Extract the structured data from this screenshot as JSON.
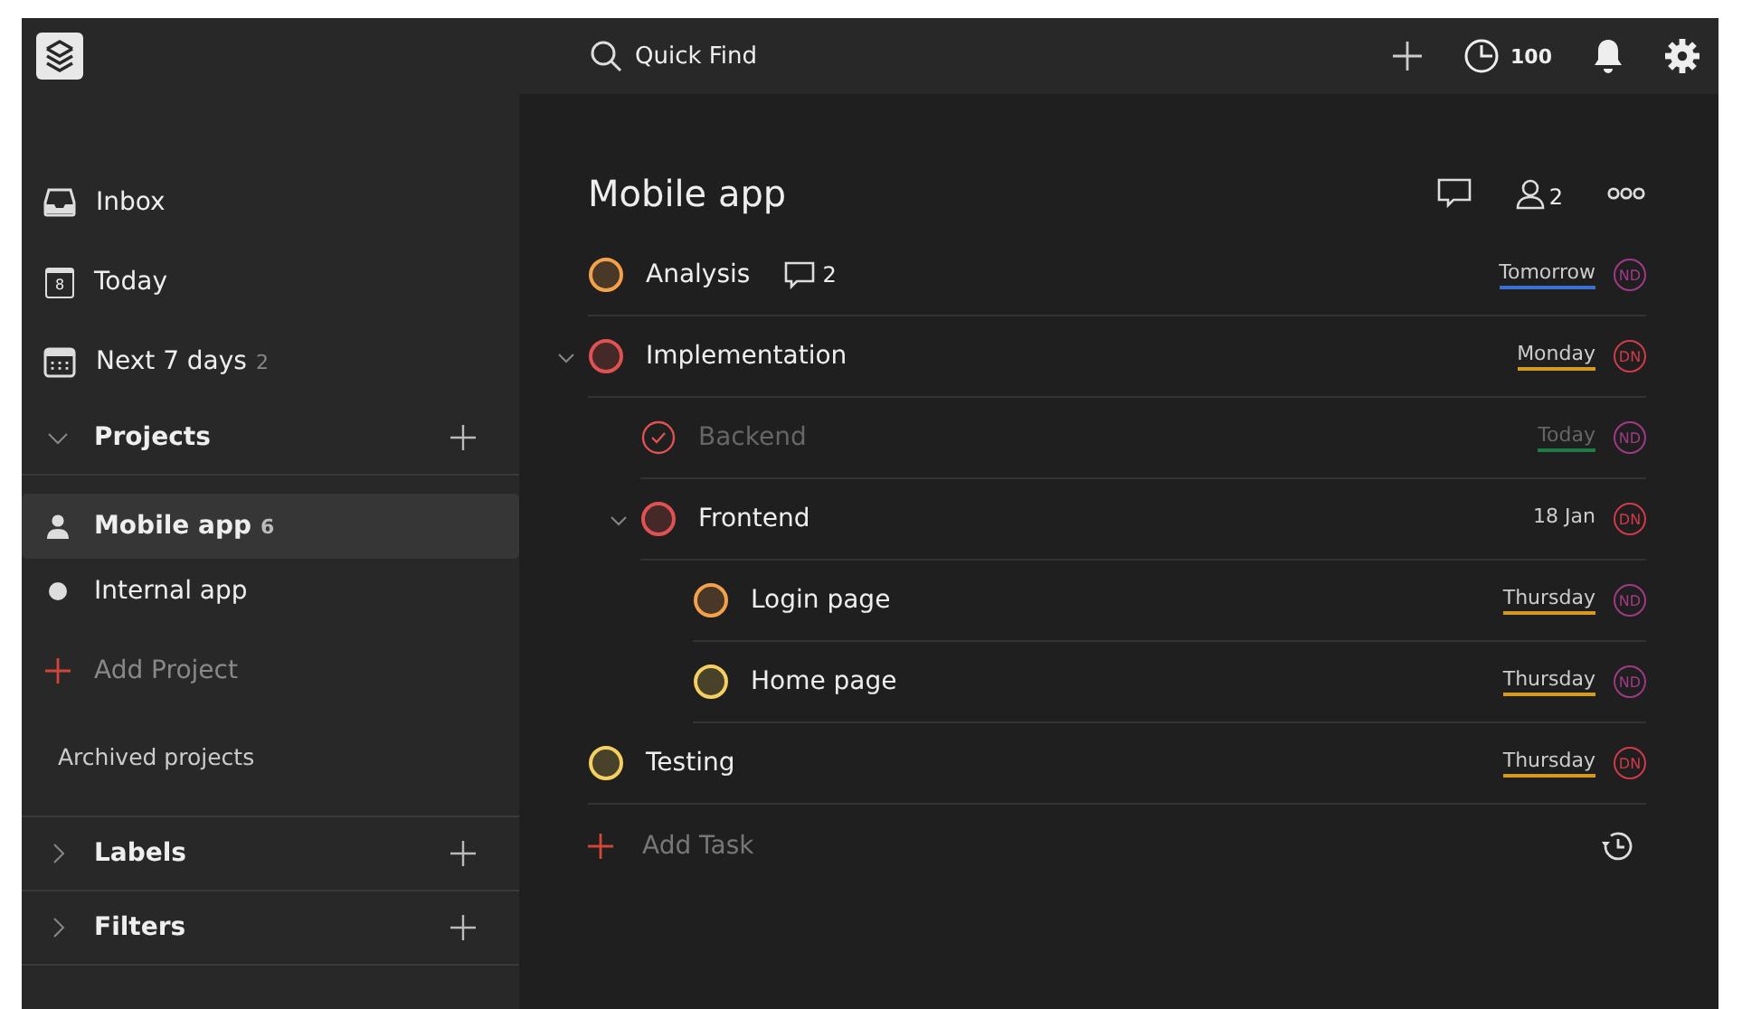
{
  "topbar": {
    "search": {
      "placeholder": "Quick Find"
    },
    "karma": "100"
  },
  "sidebar": {
    "items": [
      {
        "kind": "inbox",
        "label": "Inbox"
      },
      {
        "kind": "today",
        "label": "Today",
        "day": "8"
      },
      {
        "kind": "upcoming",
        "label": "Next 7 days",
        "count": "2"
      }
    ],
    "projects": {
      "label": "Projects",
      "expanded": true,
      "items": [
        {
          "kind": "shared",
          "label": "Mobile app",
          "count": "6",
          "selected": true
        },
        {
          "kind": "personal",
          "label": "Internal app",
          "selected": false
        }
      ],
      "add": "Add Project",
      "archived": "Archived projects"
    },
    "sections": [
      {
        "label": "Labels",
        "expanded": false
      },
      {
        "label": "Filters",
        "expanded": false
      }
    ]
  },
  "project": {
    "title": "Mobile app",
    "members": "2",
    "tasks": [
      {
        "name": "Analysis",
        "completed": false,
        "color": "#f5a04a",
        "comments": "2",
        "due": {
          "text": "Tomorrow",
          "color": "#3b6fd1"
        },
        "assignee": {
          "initials": "ND",
          "color": "#a13a86"
        }
      },
      {
        "name": "Implementation",
        "completed": false,
        "color": "#e05252",
        "expanded": true,
        "due": {
          "text": "Monday",
          "color": "#d49b1e"
        },
        "assignee": {
          "initials": "DN",
          "color": "#d03a4a"
        },
        "children": [
          {
            "name": "Backend",
            "completed": true,
            "color": "#e05252",
            "due": {
              "text": "Today",
              "color": "#1f7a45"
            },
            "assignee": {
              "initials": "ND",
              "color": "#a13a86"
            }
          },
          {
            "name": "Frontend",
            "completed": false,
            "color": "#e05252",
            "expanded": true,
            "due": {
              "text": "18 Jan"
            },
            "assignee": {
              "initials": "DN",
              "color": "#d03a4a"
            },
            "children": [
              {
                "name": "Login page",
                "completed": false,
                "color": "#f5a04a",
                "due": {
                  "text": "Thursday",
                  "color": "#d49b1e"
                },
                "assignee": {
                  "initials": "ND",
                  "color": "#a13a86"
                }
              },
              {
                "name": "Home page",
                "completed": false,
                "color": "#f5d060",
                "due": {
                  "text": "Thursday",
                  "color": "#d49b1e"
                },
                "assignee": {
                  "initials": "ND",
                  "color": "#a13a86"
                }
              }
            ]
          }
        ]
      },
      {
        "name": "Testing",
        "completed": false,
        "color": "#f5d060",
        "due": {
          "text": "Thursday",
          "color": "#d49b1e"
        },
        "assignee": {
          "initials": "DN",
          "color": "#d03a4a"
        }
      }
    ],
    "add": "Add Task"
  }
}
